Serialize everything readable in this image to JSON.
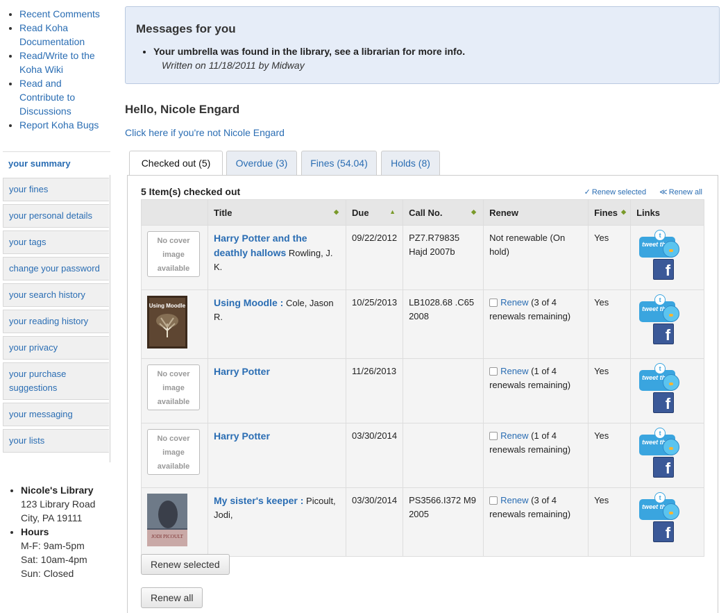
{
  "sidebar": {
    "links": [
      "Recent Comments",
      "Read Koha Documentation",
      "Read/Write to the Koha Wiki",
      "Read and Contribute to Discussions",
      "Report Koha Bugs"
    ],
    "menu": [
      "your summary",
      "your fines",
      "your personal details",
      "your tags",
      "change your password",
      "your search history",
      "your reading history",
      "your privacy",
      "your purchase suggestions",
      "your messaging",
      "your lists"
    ],
    "library": {
      "name": "Nicole's Library",
      "address1": "123 Library Road",
      "address2": "City, PA 19111",
      "hours_label": "Hours",
      "hours1": "M-F: 9am-5pm",
      "hours2": "Sat: 10am-4pm",
      "hours3": "Sun: Closed"
    }
  },
  "messages": {
    "title": "Messages for you",
    "item": "Your umbrella was found in the library, see a librarian for more info.",
    "written": "Written on 11/18/2011 by Midway"
  },
  "greeting": "Hello, Nicole Engard",
  "not_you": "Click here if you're not Nicole Engard",
  "tabs": [
    "Checked out (5)",
    "Overdue (3)",
    "Fines (54.04)",
    "Holds (8)"
  ],
  "checkouts": {
    "heading": "5 Item(s) checked out",
    "renew_selected_link": "Renew selected",
    "renew_all_link": "Renew all",
    "columns": [
      "Title",
      "Due",
      "Call No.",
      "Renew",
      "Fines",
      "Links"
    ],
    "no_cover_text": "No cover image available",
    "rows": [
      {
        "title": "Harry Potter and the deathly hallows",
        "author": "Rowling, J. K.",
        "due": "09/22/2012",
        "overdue": true,
        "callno": "PZ7.R79835 Hajd 2007b",
        "renew_link": "",
        "renew_text": "Not renewable (On hold)",
        "fines": "Yes"
      },
      {
        "title": "Using Moodle :",
        "author": "Cole, Jason R.",
        "due": "10/25/2013",
        "overdue": true,
        "callno": "LB1028.68 .C65 2008",
        "renew_link": "Renew",
        "renew_text": "(3 of 4 renewals remaining)",
        "fines": "Yes"
      },
      {
        "title": "Harry Potter",
        "author": "",
        "due": "11/26/2013",
        "overdue": true,
        "callno": "",
        "renew_link": "Renew",
        "renew_text": "(1 of 4 renewals remaining)",
        "fines": "Yes"
      },
      {
        "title": "Harry Potter",
        "author": "",
        "due": "03/30/2014",
        "overdue": false,
        "callno": "",
        "renew_link": "Renew",
        "renew_text": "(1 of 4 renewals remaining)",
        "fines": "Yes"
      },
      {
        "title": "My sister's keeper :",
        "author": "Picoult, Jodi,",
        "due": "03/30/2014",
        "overdue": false,
        "callno": "PS3566.I372 M9 2005",
        "renew_link": "Renew",
        "renew_text": "(3 of 4 renewals remaining)",
        "fines": "Yes"
      }
    ],
    "cover_texts": {
      "moodle": "Using Moodle",
      "jodi": "JODI PICOULT"
    },
    "tweet_text": "tweet this",
    "fb_text": "f",
    "bubble_text": "t"
  },
  "buttons": {
    "renew_selected": "Renew selected",
    "renew_all": "Renew all"
  }
}
